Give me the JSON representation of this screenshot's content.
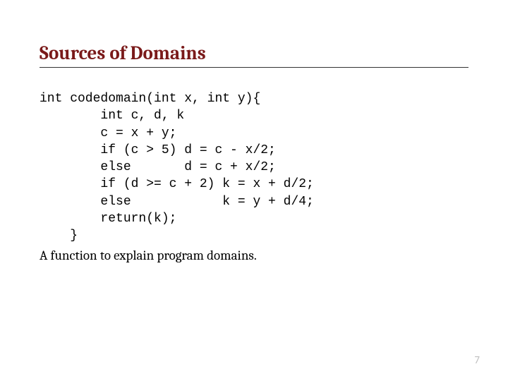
{
  "title": "Sources of Domains",
  "code": "int codedomain(int x, int y){\n        int c, d, k\n        c = x + y;\n        if (c > 5) d = c - x/2;\n        else       d = c + x/2;\n        if (d >= c + 2) k = x + d/2;\n        else            k = y + d/4;\n        return(k);\n    }",
  "caption": "A function to explain program domains.",
  "page_number": "7"
}
